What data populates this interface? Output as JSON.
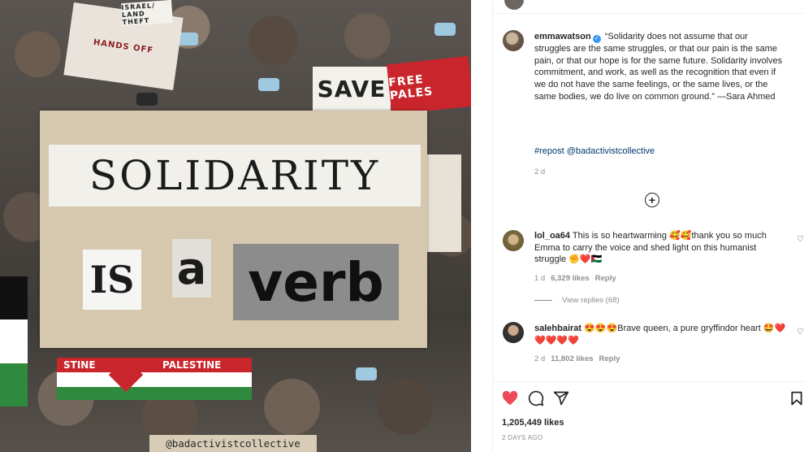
{
  "post_image": {
    "headline": "SOLIDARITY",
    "word_is": "IS",
    "word_a": "a",
    "word_verb": "verb",
    "watermark": "@badactivistcollective",
    "signs": {
      "save": "SAVE",
      "free_palestine": "FREE PALES",
      "hands_off": "HANDS OFF",
      "israel_land_theft": "ISRAEL/ LAND THEFT",
      "stine": "STINE",
      "palestine": "PALESTINE"
    }
  },
  "caption": {
    "username": "emmawatson",
    "verified_icon": "verified-badge-icon",
    "text": "“Solidarity does not assume that our struggles are the same struggles, or that our pain is the same pain, or that our hope is for the same future. Solidarity involves commitment, and work, as well as the recognition that even if we do not have the same feelings, or the same lives, or the same bodies, we do live on common ground.” —Sara Ahmed",
    "hashtag": "#repost @badactivistcollective",
    "time": "2 d"
  },
  "load_more_icon": "plus-circle-icon",
  "comments": [
    {
      "username": "lol_oa64",
      "text": "This is so heartwarming 🥰🥰thank you so much Emma to carry the voice and shed light on this humanist struggle ✊❤️🇵🇸",
      "time": "1 d",
      "likes": "6,329 likes",
      "reply": "Reply",
      "view_replies": "View replies (68)"
    },
    {
      "username": "salehbairat",
      "text": "😍😍😍Brave queen, a pure gryffindor heart 🤩❤️❤️❤️❤️❤️",
      "time": "2 d",
      "likes": "11,802 likes",
      "reply": "Reply"
    }
  ],
  "footer": {
    "likes": "1,205,449 likes",
    "posted": "2 DAYS AGO"
  },
  "colors": {
    "like_red": "#ed4956",
    "text": "#262626",
    "muted": "#8e8e8e",
    "hashtag_blue": "#00376b",
    "verified_blue": "#3897f0"
  }
}
